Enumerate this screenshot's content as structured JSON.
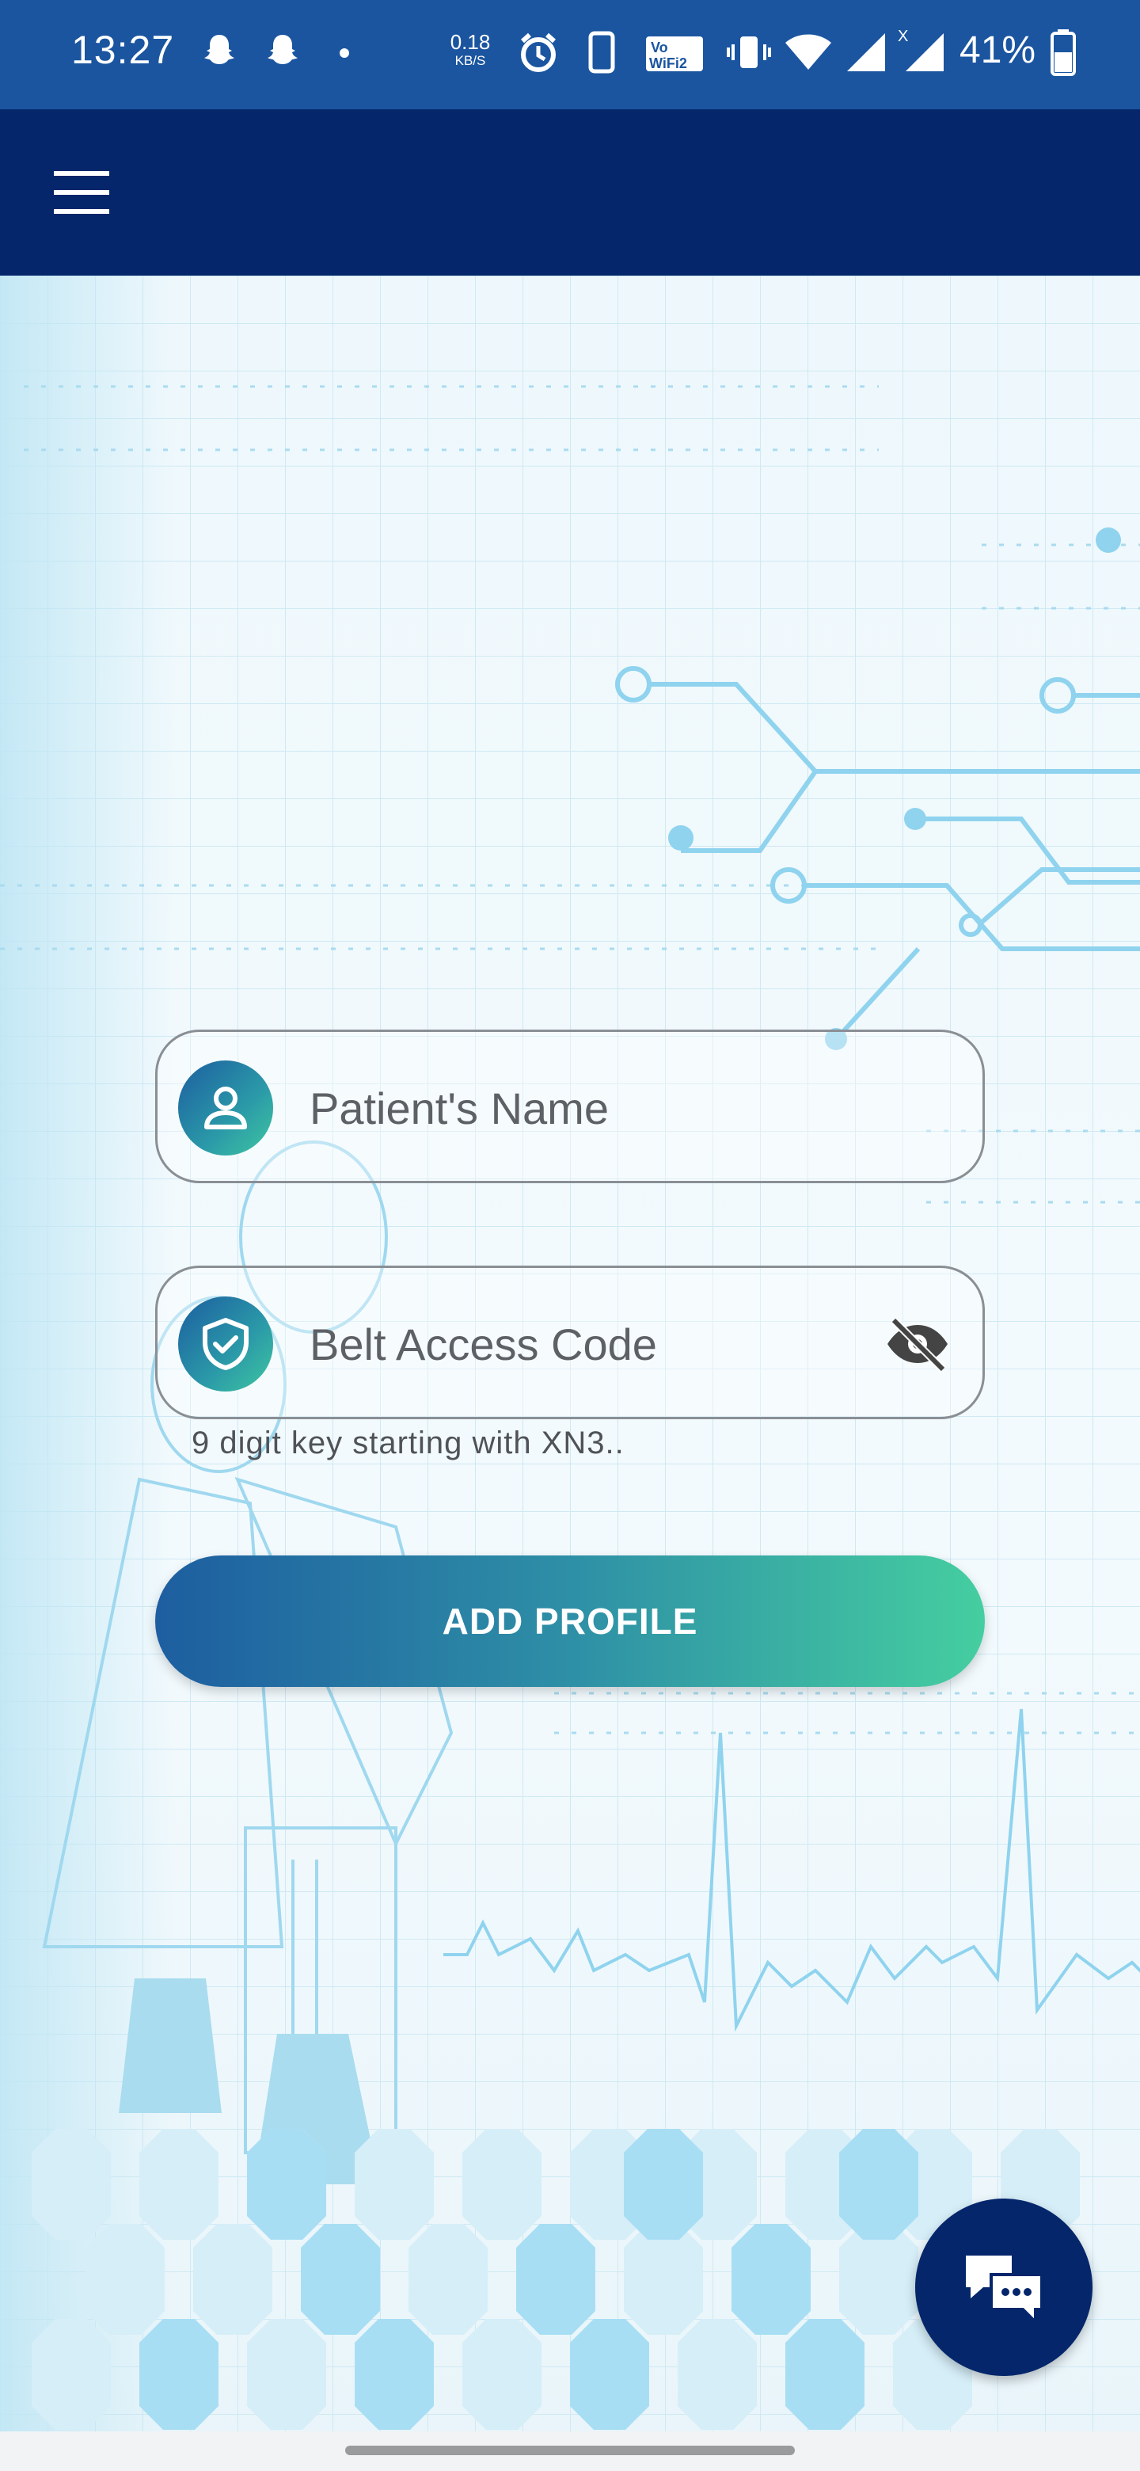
{
  "status_bar": {
    "time": "13:27",
    "net_speed_value": "0.18",
    "net_speed_unit": "KB/S",
    "battery_percent": "41%",
    "icons": [
      "snapchat-icon",
      "snapchat-icon",
      "dot-icon",
      "alarm-icon",
      "phone-icon",
      "vowifi-icon",
      "vibrate-icon",
      "wifi-icon",
      "signal-icon",
      "signal-x-icon",
      "battery-icon"
    ]
  },
  "app_bar": {
    "menu_icon": "hamburger-menu-icon"
  },
  "form": {
    "patient_name": {
      "placeholder": "Patient's Name",
      "icon": "person-icon"
    },
    "belt_access_code": {
      "placeholder": "Belt Access Code",
      "icon": "shield-check-icon",
      "toggle_icon": "eye-off-icon",
      "helper": "9 digit key starting with XN3.."
    },
    "submit_label": "ADD PROFILE"
  },
  "chat_fab": {
    "icon": "chat-bubbles-icon"
  },
  "colors": {
    "status_bar": "#1b55a0",
    "app_bar": "#05266b",
    "gradient_start": "#1d5ea0",
    "gradient_end": "#45cea0"
  }
}
